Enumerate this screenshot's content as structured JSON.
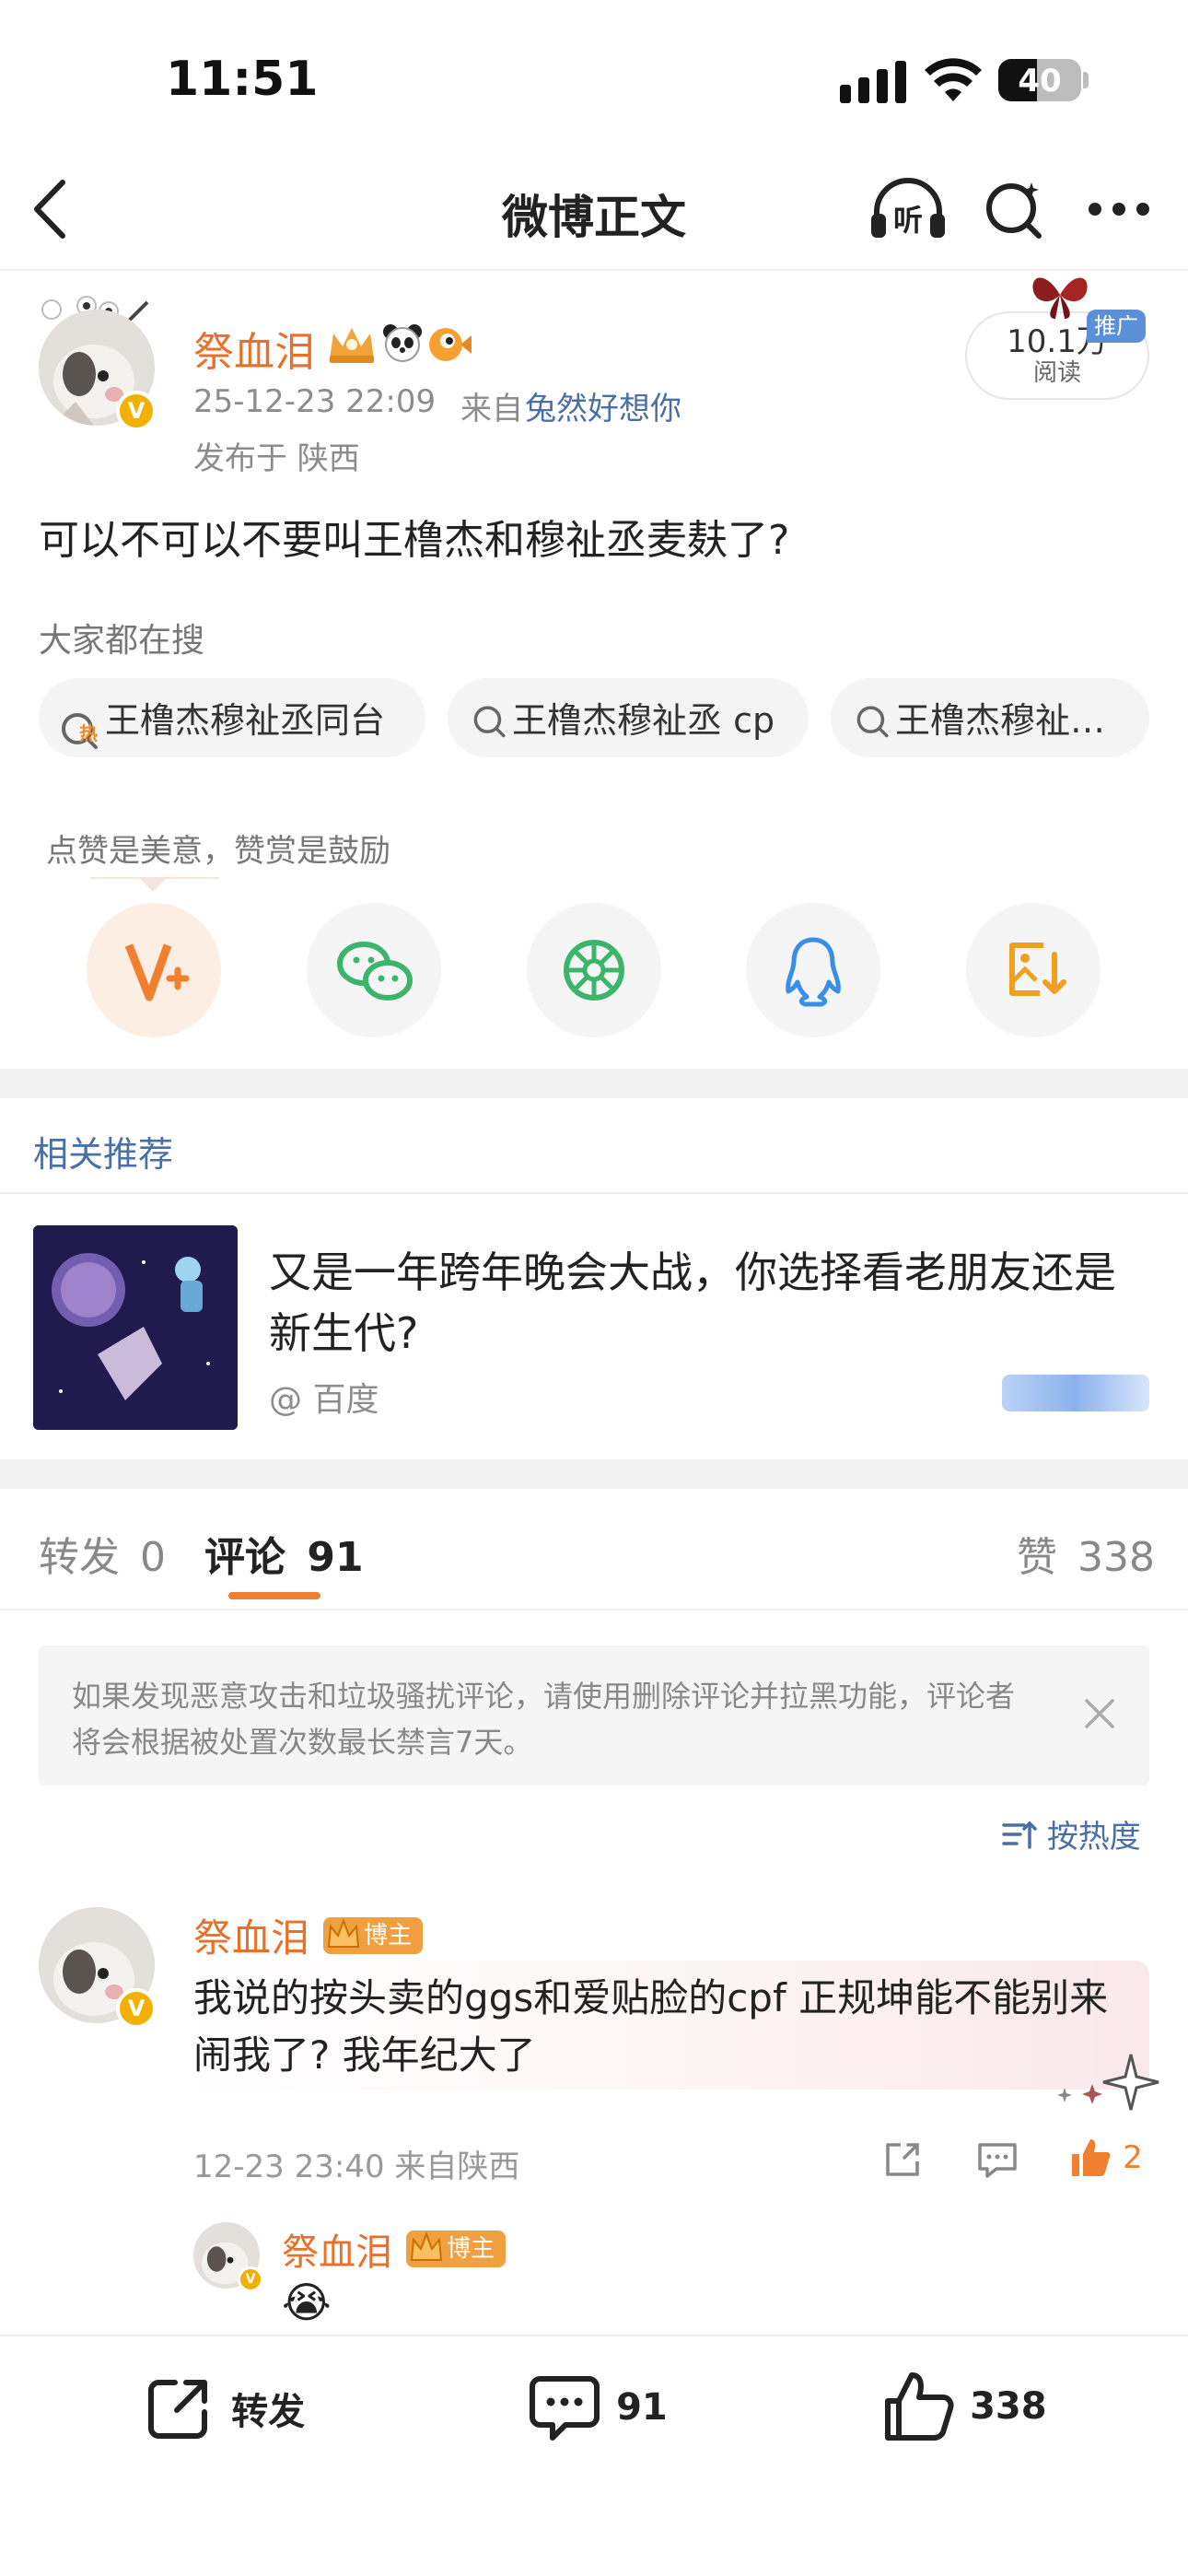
{
  "status_bar": {
    "time": "11:51",
    "battery": "40"
  },
  "nav": {
    "title": "微博正文",
    "listen_label": "听"
  },
  "post": {
    "author": "祭血泪",
    "meta_time": "25-12-23 22:09",
    "meta_from_prefix": "来自",
    "meta_source": "兔然好想你",
    "location": "发布于 陕西",
    "reads_value": "10.1万",
    "reads_label": "阅读",
    "promo_badge": "推广",
    "content": "可以不可以不要叫王橹杰和穆祉丞麦麸了?"
  },
  "search": {
    "title": "大家都在搜",
    "hot_badge": "热",
    "chips": [
      "王橹杰穆祉丞同台",
      "王橹杰穆祉丞 cp",
      "王橹杰穆祉…"
    ]
  },
  "reward": {
    "tip": "点赞是美意，赞赏是鼓励"
  },
  "related": {
    "title": "相关推荐",
    "card_title": "又是一年跨年晚会大战，你选择看老朋友还是新生代?",
    "card_source": "@ 百度"
  },
  "tabs": {
    "repost": "转发",
    "repost_count": "0",
    "comment": "评论",
    "comment_count": "91",
    "like": "赞",
    "like_count": "338"
  },
  "notice": {
    "text": "如果发现恶意攻击和垃圾骚扰评论，请使用删除评论并拉黑功能，评论者将会根据被处置次数最长禁言7天。"
  },
  "sort": {
    "label": "按热度"
  },
  "comment": {
    "author": "祭血泪",
    "badge": "博主",
    "text": "我说的按头卖的ggs和爱贴脸的cpf 正规坤能不能别来闹我了? 我年纪大了",
    "meta": "12-23 23:40 来自陕西",
    "likes": "2"
  },
  "reply": {
    "author": "祭血泪",
    "badge": "博主",
    "emoji": "😭"
  },
  "bottom_bar": {
    "repost": "转发",
    "comments": "91",
    "likes": "338"
  },
  "colors": {
    "accent": "#e8702a",
    "link": "#4a6fa5",
    "page_bg": "#ffffff",
    "gap_bg": "#f2f2f2"
  }
}
